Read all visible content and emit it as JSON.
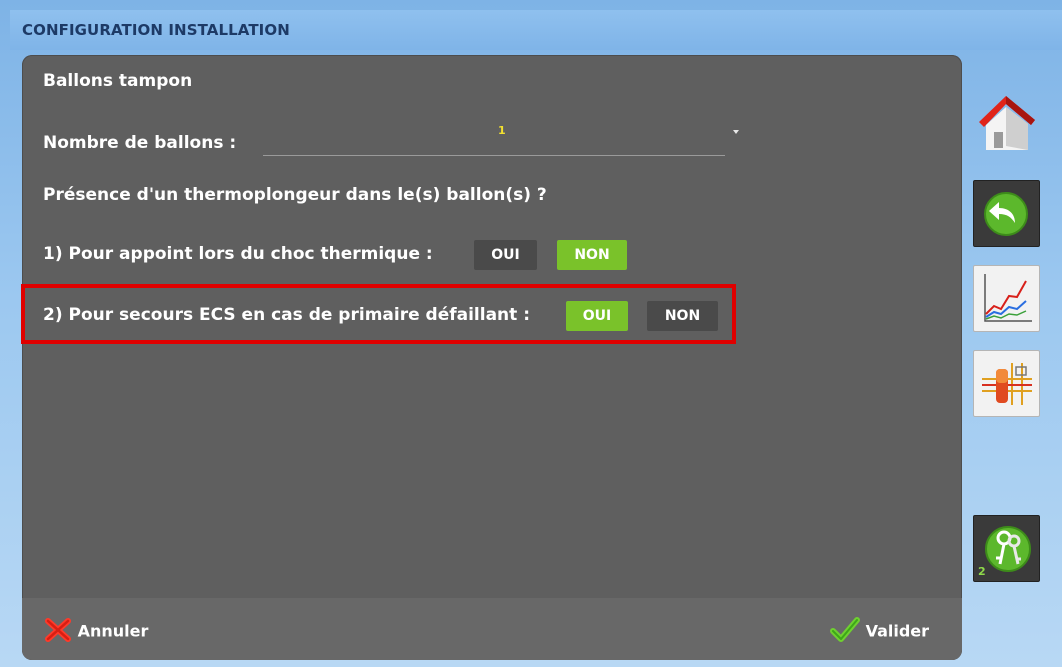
{
  "header": {
    "title": "CONFIGURATION INSTALLATION"
  },
  "panel": {
    "section_title": "Ballons tampon",
    "tank_count": {
      "label": "Nombre de ballons :",
      "value": "1"
    },
    "question": "Présence d'un thermoplongeur dans le(s) ballon(s) ?",
    "options": [
      {
        "label": "1) Pour appoint lors du choc thermique :",
        "yes": "OUI",
        "no": "NON",
        "selected": "NON"
      },
      {
        "label": "2) Pour secours ECS en cas de primaire défaillant :",
        "yes": "OUI",
        "no": "NON",
        "selected": "OUI"
      }
    ]
  },
  "footer": {
    "cancel_label": "Annuler",
    "validate_label": "Valider"
  },
  "sidebar": {
    "items": [
      {
        "icon": "home-icon"
      },
      {
        "icon": "back-arrow-icon"
      },
      {
        "icon": "trend-chart-icon"
      },
      {
        "icon": "hydraulic-schema-icon"
      },
      {
        "icon": "keys-icon",
        "badge": "2"
      }
    ]
  },
  "colors": {
    "panel": "#5f5f5f",
    "active_toggle": "#7ac22a",
    "highlight": "#e00000",
    "header_text": "#1d3a66"
  }
}
